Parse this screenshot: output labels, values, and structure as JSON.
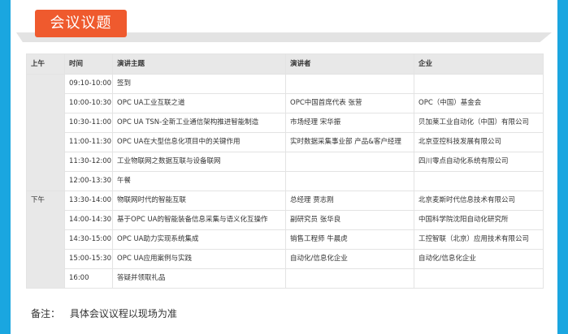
{
  "section": {
    "title": "会议议题"
  },
  "table": {
    "headers": [
      "上午",
      "时间",
      "演讲主题",
      "演讲者",
      "企业"
    ],
    "periods": {
      "morning": "上午",
      "afternoon": "下午"
    },
    "rows": [
      {
        "time": "09:10-10:00",
        "topic": "签到",
        "speaker": "",
        "company": ""
      },
      {
        "time": "10:00-10:30",
        "topic": "OPC UA工业互联之道",
        "speaker": "OPC中国首席代表 张营",
        "company": "OPC（中国）基金会"
      },
      {
        "time": "10:30-11:00",
        "topic": "OPC UA TSN-全新工业通信架构推进智能制造",
        "speaker": "市场经理 宋华振",
        "company": "贝加莱工业自动化（中国）有限公司"
      },
      {
        "time": "11:00-11:30",
        "topic": "OPC UA在大型信息化项目中的关键作用",
        "speaker": "实时数据采集事业部 产品&客户经理",
        "company": "北京亚控科技发展有限公司"
      },
      {
        "time": "11:30-12:00",
        "topic": "工业物联网之数据互联与设备联网",
        "speaker": "",
        "company": "四川零点自动化系统有限公司"
      },
      {
        "time": "12:00-13:30",
        "topic": "午餐",
        "speaker": "",
        "company": ""
      },
      {
        "time": "13:30-14:00",
        "topic": "物联网时代的智能互联",
        "speaker": "总经理 贾志刚",
        "company": "北京麦斯时代信息技术有限公司"
      },
      {
        "time": "14:00-14:30",
        "topic": "基于OPC UA的智能装备信息采集与语义化互操作",
        "speaker": "副研究员 张华良",
        "company": "中国科学院沈阳自动化研究所"
      },
      {
        "time": "14:30-15:00",
        "topic": "OPC UA助力实现系统集成",
        "speaker": "销售工程师 牛晨虎",
        "company": "工控智联（北京）应用技术有限公司"
      },
      {
        "time": "15:00-15:30",
        "topic": "OPC UA应用案例与实践",
        "speaker": "自动化/信息化企业",
        "company": "自动化/信息化企业"
      },
      {
        "time": "16:00",
        "topic": "答疑并领取礼品",
        "speaker": "",
        "company": ""
      }
    ]
  },
  "note": {
    "label": "备注：",
    "text": "具体会议议程以现场为准"
  },
  "colors": {
    "accent": "#ef5a2e",
    "edge": "#1aa6e0",
    "header_bg": "#e8e8e8",
    "border": "#e3e3e3"
  }
}
